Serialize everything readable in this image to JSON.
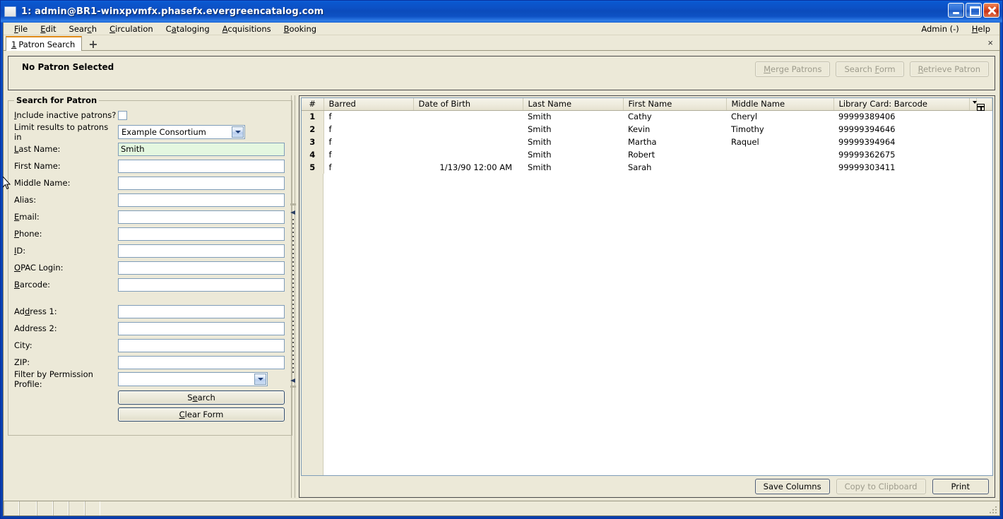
{
  "window": {
    "title": "1: admin@BR1-winxpvmfx.phasefx.evergreencatalog.com",
    "minimize_label": "Minimize",
    "maximize_label": "Maximize",
    "close_label": "Close"
  },
  "menubar": {
    "items": [
      {
        "label": "File",
        "mnemonic": "F"
      },
      {
        "label": "Edit",
        "mnemonic": "E"
      },
      {
        "label": "Search",
        "mnemonic": "c"
      },
      {
        "label": "Circulation",
        "mnemonic": "C"
      },
      {
        "label": "Cataloging",
        "mnemonic": "a"
      },
      {
        "label": "Acquisitions",
        "mnemonic": "A"
      },
      {
        "label": "Booking",
        "mnemonic": "B"
      }
    ],
    "right_items": [
      {
        "label": "Admin (-)"
      },
      {
        "label": "Help",
        "mnemonic": "H"
      }
    ]
  },
  "tabbar": {
    "tabs": [
      {
        "number": "1",
        "label": "Patron Search"
      }
    ],
    "new_tab_label": "+",
    "close_label": "×"
  },
  "patron_bar": {
    "title": "No Patron Selected",
    "buttons": [
      {
        "label": "Merge Patrons",
        "mnemonic": "M",
        "disabled": true
      },
      {
        "label": "Search Form",
        "mnemonic": "F",
        "disabled": true
      },
      {
        "label": "Retrieve Patron",
        "mnemonic": "R",
        "disabled": true
      }
    ]
  },
  "search_form": {
    "legend": "Search for Patron",
    "include_inactive": {
      "label": "Include inactive patrons?",
      "mnemonic": "I",
      "checked": false
    },
    "limit_results": {
      "label": "Limit results to patrons in",
      "value": "Example Consortium"
    },
    "fields": [
      {
        "label": "Last Name:",
        "mnemonic": "L",
        "value": "Smith",
        "active": true
      },
      {
        "label": "First Name:",
        "mnemonic": "",
        "value": "",
        "active": false
      },
      {
        "label": "Middle Name:",
        "mnemonic": "",
        "value": "",
        "active": false
      },
      {
        "label": "Alias:",
        "mnemonic": "",
        "value": "",
        "active": false
      },
      {
        "label": "Email:",
        "mnemonic": "E",
        "value": "",
        "active": false
      },
      {
        "label": "Phone:",
        "mnemonic": "P",
        "value": "",
        "active": false
      },
      {
        "label": "ID:",
        "mnemonic": "I",
        "value": "",
        "active": false
      },
      {
        "label": "OPAC Login:",
        "mnemonic": "O",
        "value": "",
        "active": false
      },
      {
        "label": "Barcode:",
        "mnemonic": "B",
        "value": "",
        "active": false
      }
    ],
    "address_fields": [
      {
        "label": "Address 1:",
        "mnemonic": "d",
        "value": ""
      },
      {
        "label": "Address 2:",
        "mnemonic": "",
        "value": ""
      },
      {
        "label": "City:",
        "mnemonic": "",
        "value": ""
      },
      {
        "label": "ZIP:",
        "mnemonic": "",
        "value": ""
      }
    ],
    "permission_profile": {
      "label": "Filter by Permission Profile:",
      "value": ""
    },
    "search_button": {
      "label": "Search",
      "mnemonic": "e"
    },
    "clear_button": {
      "label": "Clear Form",
      "mnemonic": "C"
    }
  },
  "results": {
    "columns": [
      "#",
      "Barred",
      "Date of Birth",
      "Last Name",
      "First Name",
      "Middle Name",
      "Library Card: Barcode"
    ],
    "column_picker_icon": "column-picker-icon",
    "rows": [
      {
        "num": "1",
        "barred": "f",
        "dob": "",
        "last": "Smith",
        "first": "Cathy",
        "middle": "Cheryl",
        "barcode": "99999389406"
      },
      {
        "num": "2",
        "barred": "f",
        "dob": "",
        "last": "Smith",
        "first": "Kevin",
        "middle": "Timothy",
        "barcode": "99999394646"
      },
      {
        "num": "3",
        "barred": "f",
        "dob": "",
        "last": "Smith",
        "first": "Martha",
        "middle": "Raquel",
        "barcode": "99999394964"
      },
      {
        "num": "4",
        "barred": "f",
        "dob": "",
        "last": "Smith",
        "first": "Robert",
        "middle": "",
        "barcode": "99999362675"
      },
      {
        "num": "5",
        "barred": "f",
        "dob": "1/13/90 12:00 AM",
        "last": "Smith",
        "first": "Sarah",
        "middle": "",
        "barcode": "99999303411"
      }
    ],
    "footer_buttons": [
      {
        "label": "Save Columns",
        "disabled": false
      },
      {
        "label": "Copy to Clipboard",
        "disabled": true
      },
      {
        "label": "Print",
        "disabled": false
      }
    ]
  },
  "colors": {
    "titlebar_blue": "#0b4ec4",
    "chrome_beige": "#ece9d8",
    "active_field_green": "#e4f7e0",
    "tab_accent_orange": "#e08a18",
    "field_border_blue": "#7f9db9"
  }
}
